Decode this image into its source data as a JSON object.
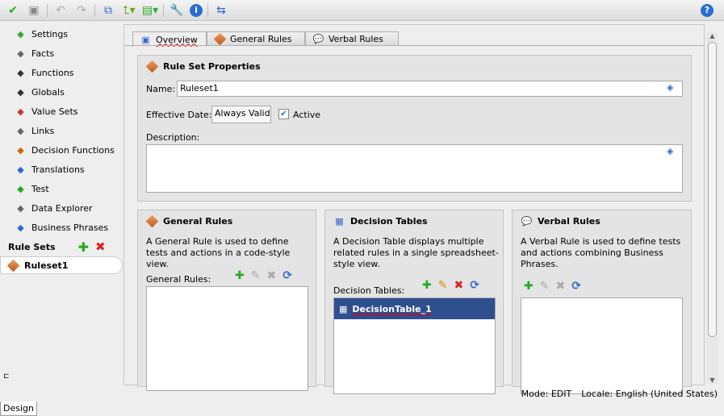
{
  "toolbar": {
    "icons": [
      "validate-icon",
      "preview-icon",
      "undo-icon",
      "redo-icon",
      "link-icon",
      "import-icon",
      "export-icon",
      "tools-icon",
      "info-icon",
      "deploy-icon",
      "help-icon"
    ]
  },
  "sidebar": {
    "items": [
      {
        "label": "Settings",
        "icon": "settings-icon"
      },
      {
        "label": "Facts",
        "icon": "facts-icon"
      },
      {
        "label": "Functions",
        "icon": "functions-icon"
      },
      {
        "label": "Globals",
        "icon": "globals-icon"
      },
      {
        "label": "Value Sets",
        "icon": "value-sets-icon"
      },
      {
        "label": "Links",
        "icon": "links-icon"
      },
      {
        "label": "Decision Functions",
        "icon": "decision-functions-icon"
      },
      {
        "label": "Translations",
        "icon": "translations-icon"
      },
      {
        "label": "Test",
        "icon": "test-icon"
      },
      {
        "label": "Data Explorer",
        "icon": "data-explorer-icon"
      },
      {
        "label": "Business Phrases",
        "icon": "business-phrases-icon"
      }
    ],
    "rule_sets_label": "Rule Sets",
    "rulesets": [
      "Ruleset1"
    ]
  },
  "tabs": [
    "Overview",
    "General Rules",
    "Verbal Rules"
  ],
  "props": {
    "title": "Rule Set Properties",
    "name_label": "Name:",
    "name_value": "Ruleset1",
    "date_label": "Effective Date:",
    "date_value": "Always Valid",
    "active_label": "Active",
    "active": true,
    "desc_label": "Description:"
  },
  "general": {
    "title": "General Rules",
    "desc": "A General Rule is used to define tests and actions in a code-style view.",
    "list_label": "General Rules:"
  },
  "decision": {
    "title": "Decision Tables",
    "desc": "A Decision Table displays multiple related rules in a single spreadsheet-style view.",
    "list_label": "Decision Tables:",
    "items": [
      "DecisionTable_1"
    ]
  },
  "verbal": {
    "title": "Verbal Rules",
    "desc": "A Verbal Rule is used to define tests and actions combining Business Phrases."
  },
  "status": {
    "mode": "Mode: EDIT",
    "locale": "Locale: English (United States)"
  },
  "bottom_tab": "Design"
}
